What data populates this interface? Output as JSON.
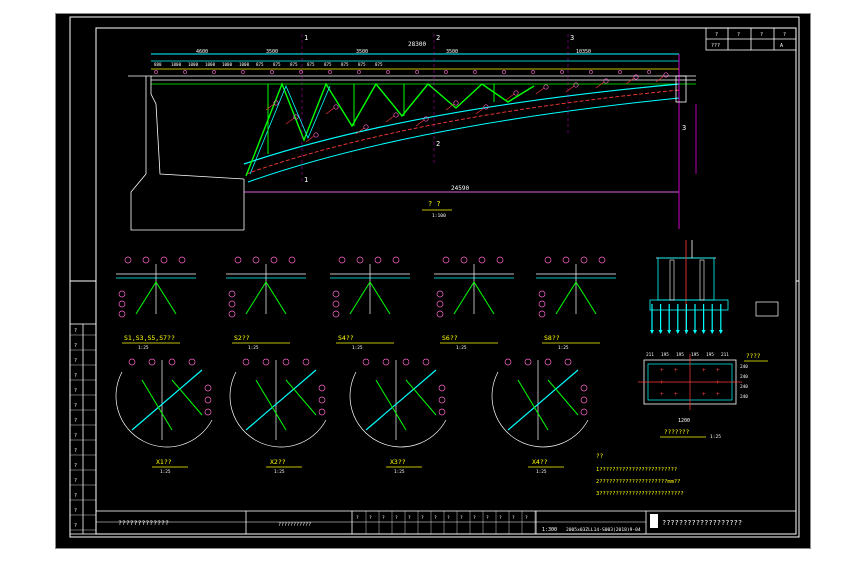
{
  "title_block": {
    "revision_header": [
      "?",
      "?",
      "?",
      "?"
    ],
    "revision_row": [
      "???",
      "A"
    ],
    "drawing_title": "???????????????????",
    "project_name": "?????????????",
    "stamp_text": "???????????",
    "scale_value": "1:300",
    "drawing_number": "2005x03ZLL14-S003(2018)9-04",
    "sign_labels": [
      "?",
      "?",
      "?",
      "?",
      "?",
      "?",
      "?",
      "?",
      "?",
      "?",
      "?",
      "?",
      "?",
      "?"
    ],
    "side_labels": [
      "?",
      "?",
      "?",
      "?",
      "?",
      "?",
      "?",
      "?",
      "?",
      "?",
      "?",
      "?",
      "?",
      "?"
    ]
  },
  "elevation": {
    "title": "? ?",
    "scale": "1:100",
    "total_span": "28300",
    "span_segments": [
      "3500",
      "3500",
      "3500",
      "10350"
    ],
    "base_span": "24590",
    "axis_marks": [
      "1",
      "1",
      "2",
      "2",
      "3",
      "3"
    ],
    "left_dim": "4600",
    "top_chord_dims": [
      "880",
      "1000",
      "1000",
      "1000",
      "1000",
      "1000",
      "875",
      "875",
      "875",
      "875",
      "875",
      "875",
      "875",
      "875"
    ]
  },
  "detail_views": [
    {
      "label": "S1,S3,S5,S7??",
      "scale": "1:25"
    },
    {
      "label": "S2??",
      "scale": "1:25"
    },
    {
      "label": "S4??",
      "scale": "1:25"
    },
    {
      "label": "S6??",
      "scale": "1:25"
    },
    {
      "label": "S8??",
      "scale": "1:25"
    },
    {
      "label": "X1??",
      "scale": "1:25"
    },
    {
      "label": "X2??",
      "scale": "1:25"
    },
    {
      "label": "X3??",
      "scale": "1:25"
    },
    {
      "label": "X4??",
      "scale": "1:25"
    },
    {
      "label": "????",
      "scale": ""
    },
    {
      "label": "???????",
      "scale": "1:25"
    }
  ],
  "dims": {
    "plate_top": [
      "211",
      "195",
      "195",
      "195",
      "195",
      "211"
    ],
    "plate_bottom": "1200",
    "plate_right": [
      "240",
      "240",
      "240",
      "240"
    ]
  },
  "notes": {
    "heading": "??",
    "lines": [
      "1????????????????????????",
      "2?????????????????????mm??",
      "3??????????????????????????"
    ]
  },
  "colors": {
    "background": "#000000",
    "frame": "#ffffff",
    "chord": "#00ffff",
    "diagonal": "#00ff00",
    "text": "#ffff00",
    "dimension": "#ff00ff",
    "leader": "#ff3a3a",
    "bubble": "#ff66cc"
  }
}
